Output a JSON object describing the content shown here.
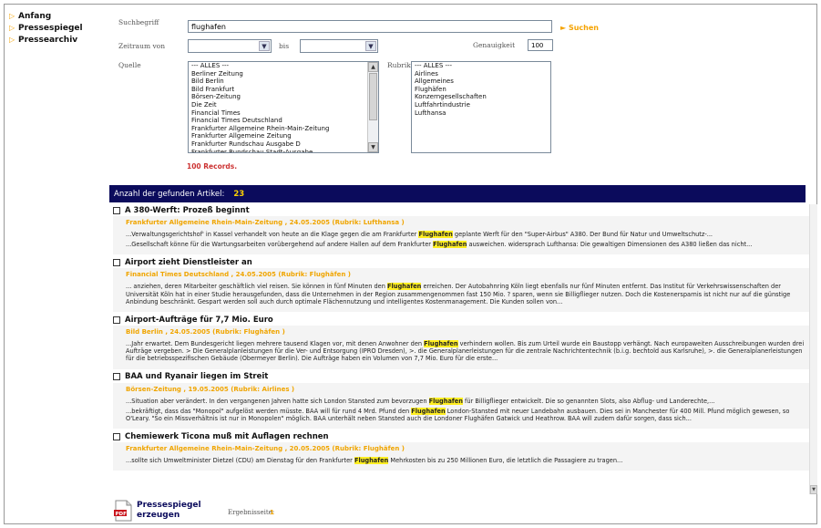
{
  "nav": [
    {
      "label": "Anfang"
    },
    {
      "label": "Pressespiegel"
    },
    {
      "label": "Pressearchiv"
    }
  ],
  "search": {
    "term_label": "Suchbegriff",
    "term_value": "flughafen",
    "suchen_label": "Suchen",
    "from_label": "Zeitraum von",
    "to_label": "bis",
    "accuracy_label": "Genauigkeit",
    "accuracy_value": "100",
    "source_label": "Quelle",
    "rubric_label": "Rubrik",
    "sources": [
      "--- ALLES ---",
      "Berliner Zeitung",
      "Bild Berlin",
      "Bild Frankfurt",
      "Börsen-Zeitung",
      "Die Zeit",
      "Financial Times",
      "Financial Times Deutschland",
      "Frankfurter Allgemeine Rhein-Main-Zeitung",
      "Frankfurter Allgemeine Zeitung",
      "Frankfurter Rundschau Ausgabe D",
      "Frankfurter Rundschau Stadt-Ausgabe"
    ],
    "rubrics": [
      "--- ALLES ---",
      "Airlines",
      "Allgemeines",
      "Flughäfen",
      "Konzerngesellschaften",
      "Luftfahrtindustrie",
      "Lufthansa"
    ],
    "records": "100 Records."
  },
  "results": {
    "header_label": "Anzahl der gefunden Artikel:",
    "count": "23",
    "articles": [
      {
        "title": "A 380-Werft: Prozeß beginnt",
        "meta": "Frankfurter Allgemeine Rhein-Main-Zeitung , 24.05.2005 (Rubrik: Lufthansa )",
        "snippets": [
          {
            "pre": "...Verwaltungsgerichtshof' in Kassel verhandelt von heute an die Klage gegen die am Frankfurter ",
            "hl": "Flughafen",
            "post": " geplante Werft für den \"Super-Airbus\" A380. Der Bund für Natur und Umweltschutz-..."
          },
          {
            "pre": "...Gesellschaft könne für die Wartungsarbeiten vorübergehend auf andere Hallen auf dem Frankfurter ",
            "hl": "Flughafen",
            "post": " ausweichen. widersprach Lufthansa: Die gewaltigen Dimensionen des A380 ließen das nicht..."
          }
        ]
      },
      {
        "title": "Airport zieht Dienstleister an",
        "meta": "Financial Times Deutschland , 24.05.2005 (Rubrik: Flughäfen )",
        "snippets": [
          {
            "pre": "... anziehen, deren Mitarbeiter geschäftlich viel reisen. Sie können in fünf Minuten den ",
            "hl": "Flughafen",
            "post": " erreichen. Der Autobahnring Köln liegt ebenfalls nur fünf Minuten entfernt. Das Institut für Verkehrswissenschaften der Universität Köln hat in einer Studie herausgefunden, dass die Unternehmen in der Region zusammengenommen fast 150 Mio. ? sparen, wenn sie Billigflieger nutzen. Doch die Kostenersparnis ist nicht nur auf die günstige Anbindung beschränkt. Gespart werden soll auch durch optimale Flächennutzung und intelligentes Kostenmanagement. Die Kunden sollen von..."
          }
        ]
      },
      {
        "title": "Airport-Aufträge für 7,7 Mio. Euro",
        "meta": "Bild Berlin , 24.05.2005 (Rubrik: Flughäfen )",
        "snippets": [
          {
            "pre": "...Jahr erwartet. Dem Bundesgericht liegen mehrere tausend Klagen vor, mit denen Anwohner den ",
            "hl": "Flughafen",
            "post": " verhindern wollen. Bis zum Urteil wurde ein Baustopp verhängt. Nach europaweiten Ausschreibungen wurden drei Aufträge vergeben. > Die Generalplanleistungen für die Ver- und Entsorgung (IPRO Dresden), >. die Generalplanerleistungen für die zentrale Nachrichtentechnik (b.i.g. bechtold aus Karlsruhe), >. die Generalplanerleistungen für die betriebsspezifischen Gebäude (Obermeyer Berlin). Die Aufträge haben ein Volumen von 7,7 Mio. Euro für die erste..."
          }
        ]
      },
      {
        "title": "BAA und Ryanair liegen im Streit",
        "meta": "Börsen-Zeitung , 19.05.2005 (Rubrik: Airlines )",
        "snippets": [
          {
            "pre": "...Situation aber verändert. In den vergangenen Jahren hatte sich London Stansted zum bevorzugen ",
            "hl": "Flughafen",
            "post": " für Billigflieger entwickelt. Die so genannten Slots, also Abflug- und Landerechte,..."
          },
          {
            "pre": "...bekräftigt, dass das \"Monopol\" aufgelöst werden müsste. BAA will für rund 4 Mrd. Pfund den ",
            "hl": "Flughafen",
            "post": " London-Stansted mit neuer Landebahn ausbauen. Dies sei in Manchester für 400 Mill. Pfund möglich gewesen, so O'Leary. \"So ein Missverhältnis ist nur in Monopolen\" möglich. BAA unterhält neben Stansted auch die Londoner Flughäfen Gatwick und Heathrow. BAA will zudem dafür sorgen, dass sich..."
          }
        ]
      },
      {
        "title": "Chemiewerk Ticona muß mit Auflagen rechnen",
        "meta": "Frankfurter Allgemeine Rhein-Main-Zeitung , 20.05.2005 (Rubrik: Flughäfen )",
        "snippets": [
          {
            "pre": "...sollte sich Umweltminister Dietzel (CDU) am Dienstag für den Frankfurter ",
            "hl": "Flughafen",
            "post": " Mehrkosten bis zu 250 Millionen Euro, die letztlich die Passagiere zu tragen..."
          }
        ]
      }
    ]
  },
  "bottom": {
    "pdf_label_line1": "Pressespiegel",
    "pdf_label_line2": "erzeugen",
    "pages_label": "Ergebnisseite:",
    "page": "1"
  }
}
